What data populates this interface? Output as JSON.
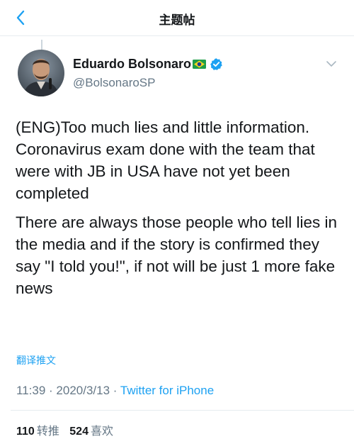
{
  "header": {
    "title": "主题帖",
    "back_icon": "chevron-left-icon"
  },
  "tweet": {
    "author": {
      "display_name": "Eduardo Bolsonaro",
      "handle": "@BolsonaroSP",
      "flag_icon": "brazil-flag-icon",
      "verified_icon": "verified-badge-icon"
    },
    "paragraphs": [
      "(ENG)Too much lies and little information. Coronavirus exam done with the team that were with JB in USA have not yet been completed",
      "There are always those people who tell lies in the media and if the story is confirmed they say \"I told you!\", if not will be just 1 more fake news"
    ],
    "translate_label": "翻译推文",
    "time": "11:39",
    "date": "2020/3/13",
    "separator": "·",
    "source": "Twitter for iPhone",
    "retweets": {
      "count": "110",
      "label": "转推"
    },
    "likes": {
      "count": "524",
      "label": "喜欢"
    }
  },
  "colors": {
    "accent": "#1da1f2",
    "text": "#14171a",
    "secondary_text": "#657786",
    "divider": "#e6ecf0"
  }
}
